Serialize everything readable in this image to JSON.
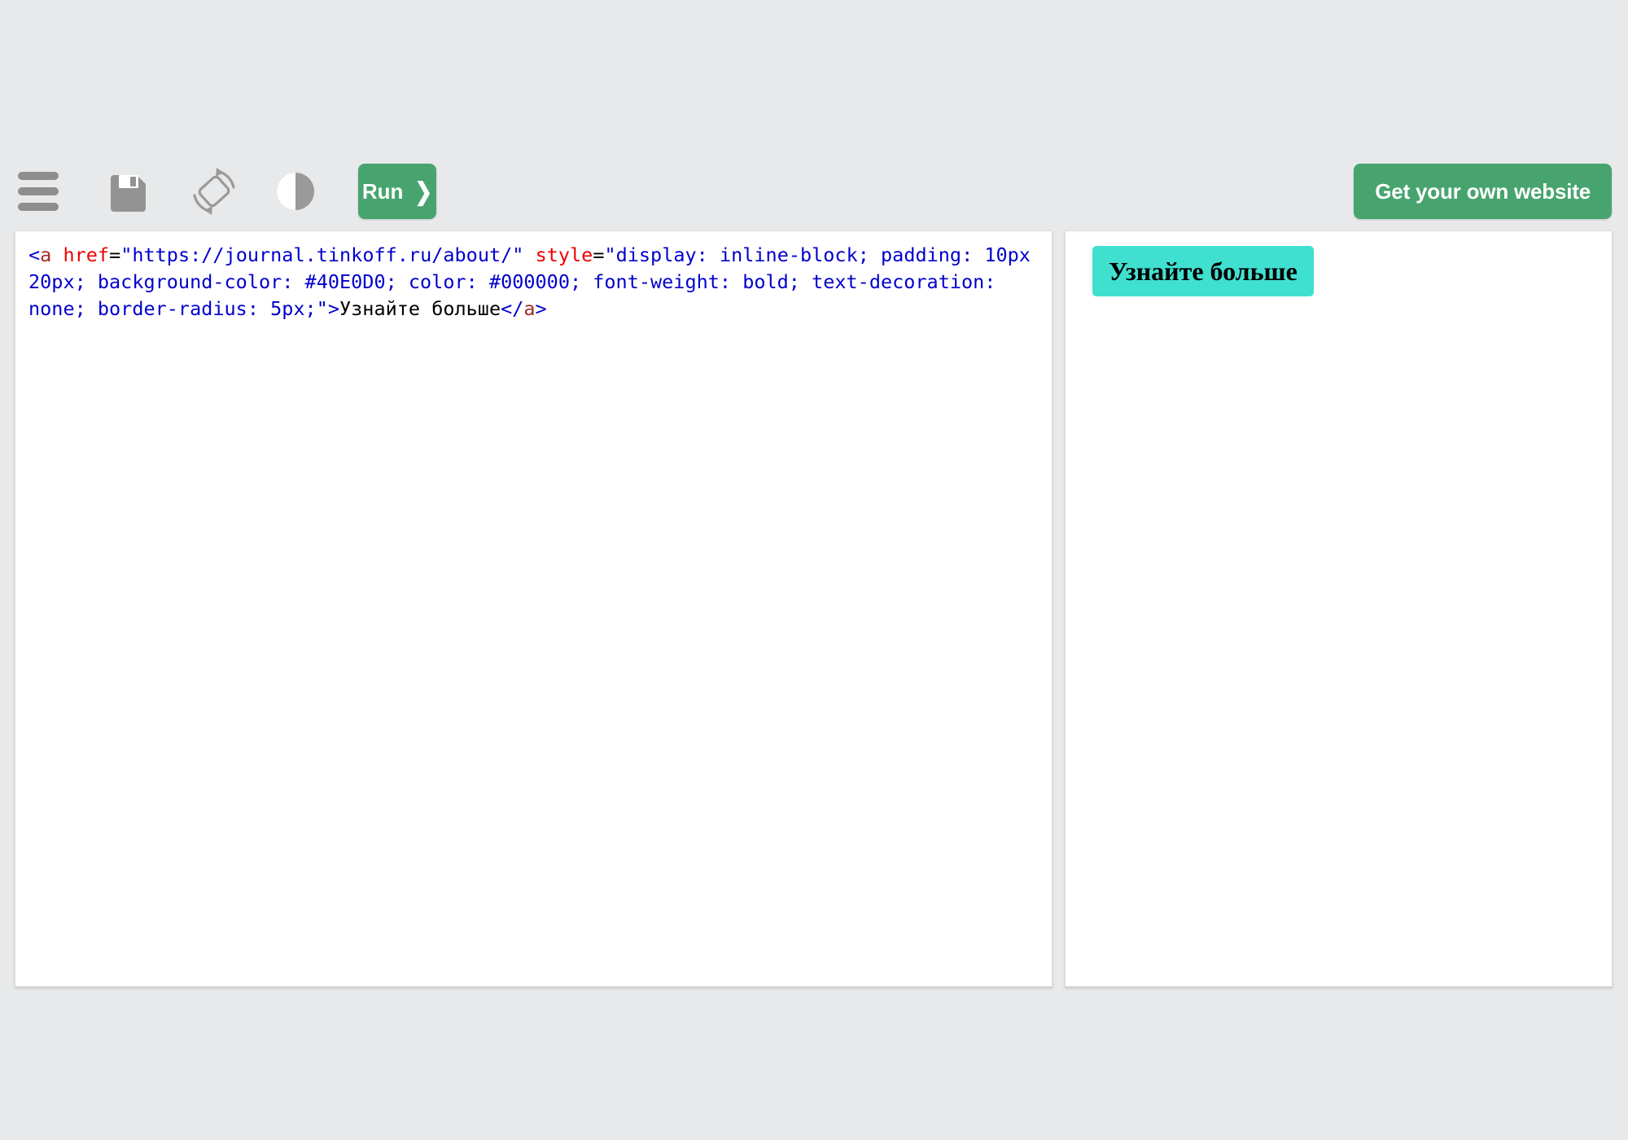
{
  "page": {
    "background_color": "#e8e9ea"
  },
  "toolbar": {
    "icons": [
      {
        "name": "menu-icon",
        "label": "Menu"
      },
      {
        "name": "save-icon",
        "label": "Save"
      },
      {
        "name": "rotate-icon",
        "label": "Rotate screen"
      },
      {
        "name": "contrast-icon",
        "label": "Contrast"
      }
    ],
    "run_button": {
      "label": "Run",
      "chevron": "❯",
      "color": "#47a46e",
      "text_color": "#ffffff"
    },
    "promo_button": {
      "label": "Get your own website",
      "color": "#47a46e",
      "text_color": "#ffffff"
    }
  },
  "editor": {
    "language": "html",
    "code_tokens": [
      {
        "type": "punct",
        "text": "<"
      },
      {
        "type": "tag",
        "text": "a"
      },
      {
        "type": "text",
        "text": " "
      },
      {
        "type": "attr",
        "text": "href"
      },
      {
        "type": "eq",
        "text": "="
      },
      {
        "type": "string",
        "text": "\"https://journal.tinkoff.ru/about/\""
      },
      {
        "type": "text",
        "text": " "
      },
      {
        "type": "attr",
        "text": "style"
      },
      {
        "type": "eq",
        "text": "="
      },
      {
        "type": "string",
        "text": "\"display: inline-block; padding: 10px 20px; background-color: #40E0D0; color: #000000; font-weight: bold; text-decoration: none; border-radius: 5px;\""
      },
      {
        "type": "punct",
        "text": ">"
      },
      {
        "type": "text",
        "text": "Узнайте больше"
      },
      {
        "type": "punct",
        "text": "</"
      },
      {
        "type": "tag",
        "text": "a"
      },
      {
        "type": "punct",
        "text": ">"
      }
    ],
    "plain_code": "<a href=\"https://journal.tinkoff.ru/about/\" style=\"display: inline-block; padding: 10px 20px; background-color: #40E0D0; color: #000000; font-weight: bold; text-decoration: none; border-radius: 5px;\">Узнайте больше</a>"
  },
  "preview": {
    "link": {
      "label": "Узнайте больше",
      "href": "https://journal.tinkoff.ru/about/",
      "background_color": "#40E0D0",
      "text_color": "#000000",
      "border_radius": "5px",
      "padding": "10px 20px"
    }
  }
}
